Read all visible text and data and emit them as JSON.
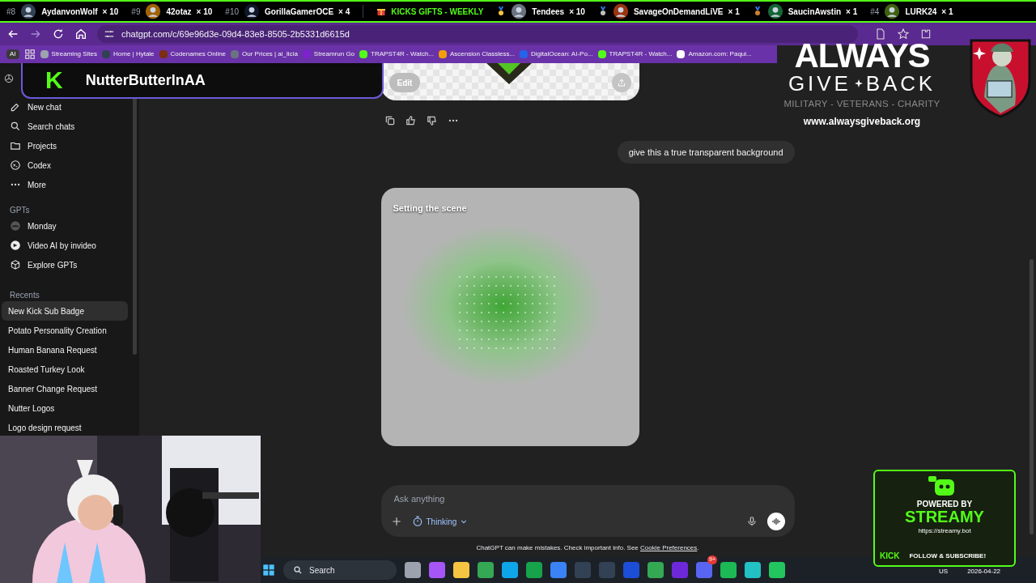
{
  "ticker": [
    {
      "kind": "leader",
      "rank": "#8",
      "name": "AydanvonWolf",
      "count": "× 10"
    },
    {
      "kind": "leader",
      "rank": "#9",
      "name": "42otaz",
      "count": "× 10"
    },
    {
      "kind": "leader",
      "rank": "#10",
      "name": "GorillaGamerOCE",
      "count": "× 4"
    },
    {
      "kind": "banner",
      "name": "KICKS GIFTS - WEEKLY"
    },
    {
      "kind": "medal",
      "name": "Tendees",
      "count": "× 10"
    },
    {
      "kind": "medal",
      "name": "SavageOnDemandLiVE",
      "count": "× 1"
    },
    {
      "kind": "medal",
      "name": "SaucinAwstin",
      "count": "× 1"
    },
    {
      "kind": "leader",
      "rank": "#4",
      "name": "LURK24",
      "count": "× 1"
    }
  ],
  "browser": {
    "url": "chatgpt.com/c/69e96d3e-09d4-83e8-8505-2b5331d6615d",
    "profile": "AI",
    "bookmarks": [
      "Streaming Sites",
      "Home | Hytale",
      "Codenames Online",
      "Our Prices | ai_licia",
      "Streamrun Go",
      "TRAPST4R - Watch...",
      "Ascension Classless...",
      "DigitalOcean: AI-Po...",
      "TRAPST4R - Watch...",
      "Amazon.com: Paqui..."
    ]
  },
  "kick_overlay": {
    "letter": "K",
    "name": "NutterButterInAA"
  },
  "sidebar": {
    "nav": [
      {
        "kind": "edit",
        "label": "New chat"
      },
      {
        "kind": "search",
        "label": "Search chats"
      },
      {
        "kind": "folder",
        "label": "Projects"
      },
      {
        "kind": "terminal",
        "label": "Codex"
      },
      {
        "kind": "dots",
        "label": "More"
      }
    ],
    "gpts_heading": "GPTs",
    "gpts": [
      {
        "kind": "avatar",
        "label": "Monday"
      },
      {
        "kind": "badge",
        "label": "Video AI by invideo"
      },
      {
        "kind": "cube",
        "label": "Explore GPTs"
      }
    ],
    "recents_heading": "Recents",
    "recents": [
      {
        "label": "New Kick Sub Badge",
        "selected": true
      },
      {
        "label": "Potato Personality Creation",
        "selected": false
      },
      {
        "label": "Human Banana Request",
        "selected": false
      },
      {
        "label": "Roasted Turkey Look",
        "selected": false
      },
      {
        "label": "Banner Change Request",
        "selected": false
      },
      {
        "label": "Nutter Logos",
        "selected": false
      },
      {
        "label": "Logo design request",
        "selected": false
      }
    ]
  },
  "chat": {
    "edit_label": "Edit",
    "user_message": "give this a true transparent background",
    "generating_label": "Setting the scene",
    "composer": {
      "placeholder": "Ask anything",
      "mode": "Thinking"
    },
    "disclaimer": "ChatGPT can make mistakes. Check important info. See ",
    "disclaimer_link": "Cookie Preferences",
    "disclaimer_end": "."
  },
  "charity": {
    "word1": "ALWAYS",
    "word2a": "GIVE",
    "word2b": "BACK",
    "tagline": "MILITARY - VETERANS - CHARITY",
    "url": "www.alwaysgiveback.org"
  },
  "streamy": {
    "line1": "POWERED BY",
    "line2": "STREAMY",
    "url": "https://streamy.bot",
    "platform": "KICK",
    "cta": "FOLLOW & SUBSCRIBE!"
  },
  "taskbar": {
    "search": "Search",
    "notification": "9+",
    "language": "US",
    "date": "2026-04-22"
  }
}
